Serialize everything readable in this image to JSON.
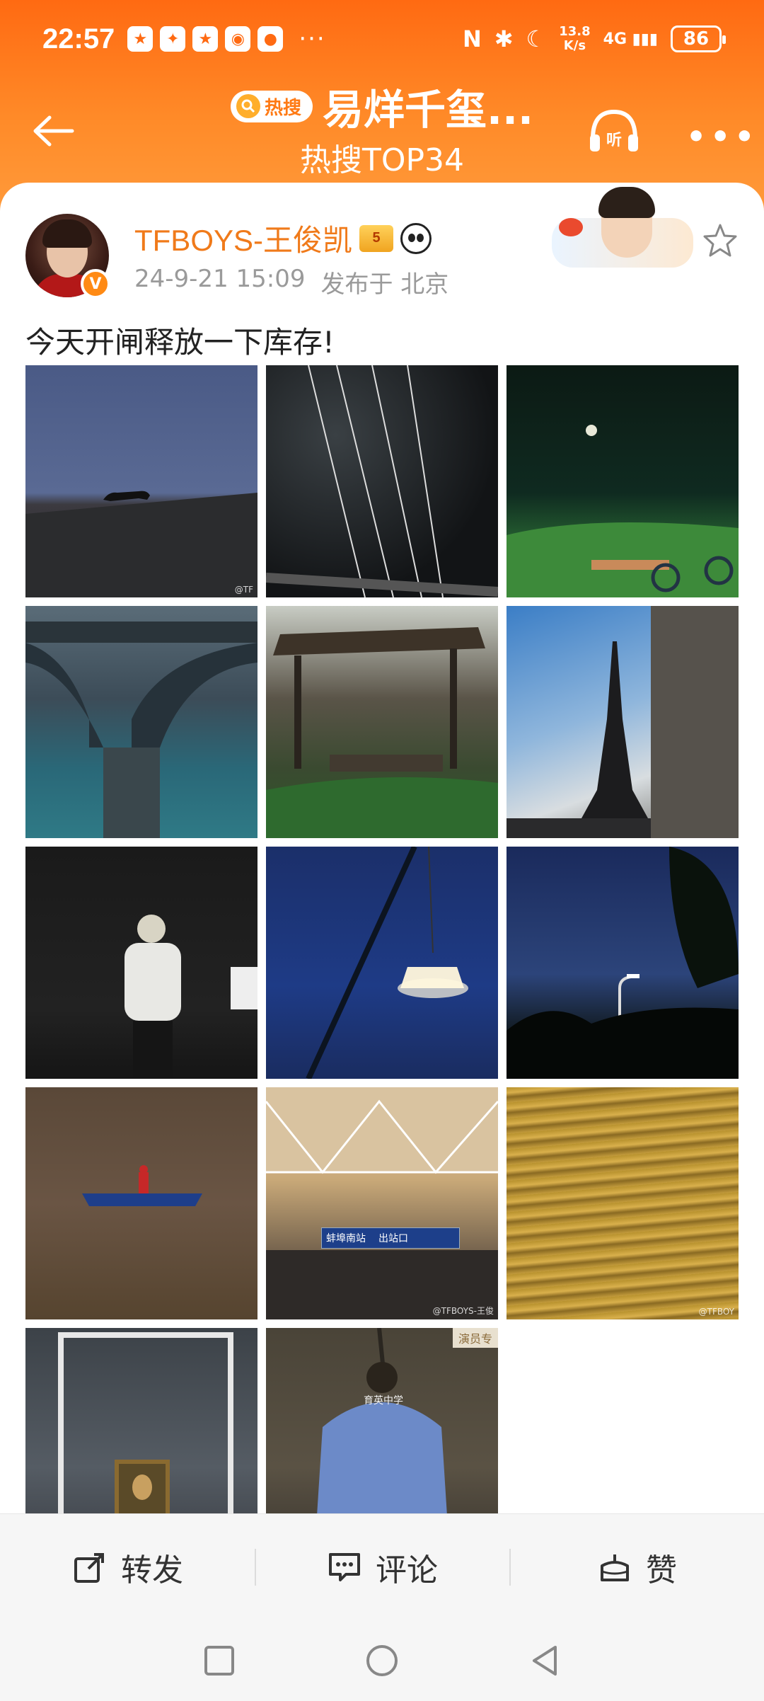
{
  "status": {
    "time": "22:57",
    "net_speed": "13.8",
    "net_unit": "K/s",
    "signal": "4G",
    "battery": "86"
  },
  "nav": {
    "hot_label": "热搜",
    "title": "易烊千玺...",
    "subtitle": "热搜TOP34"
  },
  "post": {
    "username": "TFBOYS-王俊凯",
    "crown_badge": "5",
    "date": "24-9-21 15:09",
    "location": "发布于 北京",
    "text": "今天开闸释放一下库存!",
    "verified_mark": "V",
    "images": [
      {
        "name": "cat-on-roof",
        "watermark": "@TF"
      },
      {
        "name": "wires-night",
        "watermark": ""
      },
      {
        "name": "moon-grass",
        "watermark": ""
      },
      {
        "name": "bridge-river",
        "watermark": ""
      },
      {
        "name": "shed-ruins",
        "watermark": ""
      },
      {
        "name": "eiffel-tower",
        "watermark": ""
      },
      {
        "name": "person-dark-room",
        "watermark": ""
      },
      {
        "name": "hanging-lamp",
        "watermark": ""
      },
      {
        "name": "street-lamp-night",
        "watermark": ""
      },
      {
        "name": "buoy-boat",
        "watermark": ""
      },
      {
        "name": "train-station",
        "watermark": "@TFBOYS-王俊"
      },
      {
        "name": "golden-water",
        "watermark": "@TFBOY"
      },
      {
        "name": "mona-lisa",
        "watermark": ""
      },
      {
        "name": "back-jacket",
        "watermark": ""
      }
    ],
    "station_sign": "蚌埠南站",
    "station_exit": "出站口",
    "actor_label": "演员专",
    "jacket_text": "育英中学"
  },
  "actions": {
    "repost": "转发",
    "comment": "评论",
    "like": "赞"
  },
  "colors": {
    "brand_orange": "#ff7a14",
    "username": "#f07a1a"
  }
}
